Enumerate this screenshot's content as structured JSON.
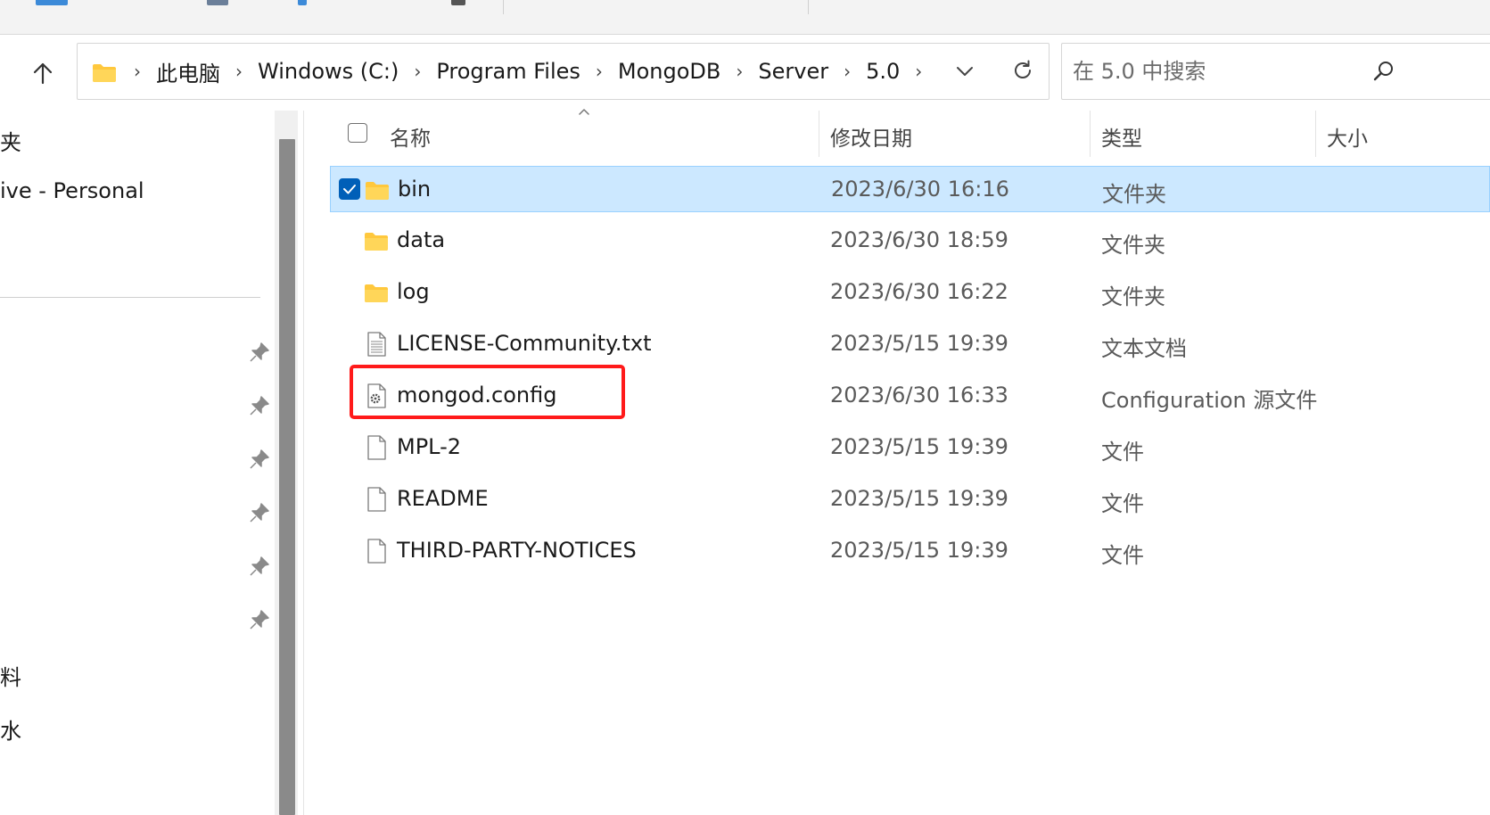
{
  "address": {
    "breadcrumbs": [
      "此电脑",
      "Windows (C:)",
      "Program Files",
      "MongoDB",
      "Server",
      "5.0"
    ]
  },
  "search": {
    "placeholder": "在 5.0 中搜索"
  },
  "nav": {
    "items": [
      {
        "label": "夹"
      },
      {
        "label": "ive - Personal"
      },
      {
        "label": "料"
      },
      {
        "label": "水"
      }
    ]
  },
  "columns": {
    "name": "名称",
    "date": "修改日期",
    "type": "类型",
    "size": "大小"
  },
  "files": [
    {
      "name": "bin",
      "date": "2023/6/30 16:16",
      "type": "文件夹",
      "icon": "folder-icon",
      "selected": true
    },
    {
      "name": "data",
      "date": "2023/6/30 18:59",
      "type": "文件夹",
      "icon": "folder-icon",
      "selected": false
    },
    {
      "name": "log",
      "date": "2023/6/30 16:22",
      "type": "文件夹",
      "icon": "folder-icon",
      "selected": false
    },
    {
      "name": "LICENSE-Community.txt",
      "date": "2023/5/15 19:39",
      "type": "文本文档",
      "icon": "text-file-icon",
      "selected": false
    },
    {
      "name": "mongod.config",
      "date": "2023/6/30 16:33",
      "type": "Configuration 源文件",
      "icon": "config-file-icon",
      "selected": false
    },
    {
      "name": "MPL-2",
      "date": "2023/5/15 19:39",
      "type": "文件",
      "icon": "file-icon",
      "selected": false
    },
    {
      "name": "README",
      "date": "2023/5/15 19:39",
      "type": "文件",
      "icon": "file-icon",
      "selected": false
    },
    {
      "name": "THIRD-PARTY-NOTICES",
      "date": "2023/5/15 19:39",
      "type": "文件",
      "icon": "file-icon",
      "selected": false
    }
  ],
  "colors": {
    "selection_bg": "#cce8ff",
    "selection_border": "#99d1ff",
    "checkbox_accent": "#005fb8",
    "highlight_annotation": "#ff1a1a",
    "folder_yellow": "#ffc83d"
  }
}
